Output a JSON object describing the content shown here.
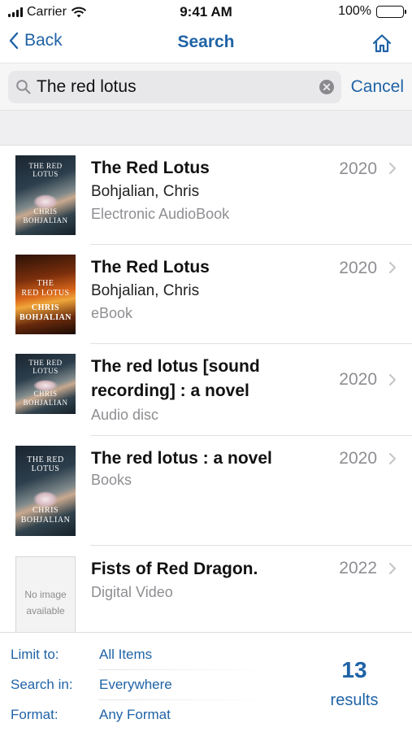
{
  "status_bar": {
    "carrier": "Carrier",
    "time": "9:41 AM",
    "battery": "100%"
  },
  "nav": {
    "back_label": "Back",
    "title": "Search",
    "home_icon": "home-icon"
  },
  "search": {
    "query": "The red lotus",
    "cancel_label": "Cancel",
    "search_icon": "magnifier-icon",
    "clear_icon": "clear-icon"
  },
  "results": [
    {
      "title": "The Red Lotus",
      "author": "Bohjalian, Chris",
      "format": "Electronic AudioBook",
      "year": "2020",
      "cover": {
        "title": "THE RED LOTUS",
        "author_line1": "CHRIS",
        "author_line2": "BOHJALIAN"
      }
    },
    {
      "title": "The Red Lotus",
      "author": "Bohjalian, Chris",
      "format": "eBook",
      "year": "2020",
      "cover": {
        "title_line1": "THE",
        "title_line2": "RED LOTUS",
        "author_line1": "CHRIS",
        "author_line2": "BOHJALIAN"
      }
    },
    {
      "title": "The red lotus [sound recording] : a novel",
      "format": "Audio disc",
      "year": "2020",
      "cover": {
        "title": "THE RED LOTUS",
        "author_line1": "CHRIS",
        "author_line2": "BOHJALIAN"
      }
    },
    {
      "title": "The red lotus : a novel",
      "format": "Books",
      "year": "2020",
      "cover": {
        "title": "THE RED LOTUS",
        "author_line1": "CHRIS",
        "author_line2": "BOHJALIAN"
      }
    },
    {
      "title": "Fists of Red Dragon.",
      "format": "Digital Video",
      "year": "2022",
      "cover": {
        "placeholder_line1": "No image",
        "placeholder_line2": "available"
      }
    }
  ],
  "footer": {
    "limit_label": "Limit to:",
    "limit_value": "All Items",
    "search_in_label": "Search in:",
    "search_in_value": "Everywhere",
    "format_label": "Format:",
    "format_value": "Any Format",
    "count": "13",
    "count_label": "results"
  },
  "colors": {
    "accent": "#1f63a6",
    "secondary_text": "#8e8e93",
    "band": "#efeff2"
  }
}
